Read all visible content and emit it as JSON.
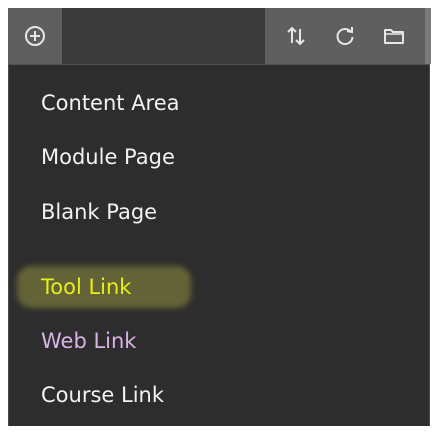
{
  "toolbar": {
    "add_icon": "plus-circle-icon",
    "sort_icon": "sort-arrows-icon",
    "refresh_icon": "refresh-icon",
    "folder_icon": "folder-icon"
  },
  "menu": {
    "items": [
      {
        "label": "Content Area"
      },
      {
        "label": "Module Page"
      },
      {
        "label": "Blank Page"
      },
      {
        "label": "Tool Link"
      },
      {
        "label": "Web Link"
      },
      {
        "label": "Course Link"
      }
    ]
  },
  "colors": {
    "menu_background": "#2d2d2d",
    "toolbar_background": "#5f5f5f",
    "tool_link_text": "#e8ee1a",
    "tool_link_highlight": "#c9c84a",
    "web_link_text": "#d9b2e6",
    "default_text": "#f2f2f2"
  }
}
